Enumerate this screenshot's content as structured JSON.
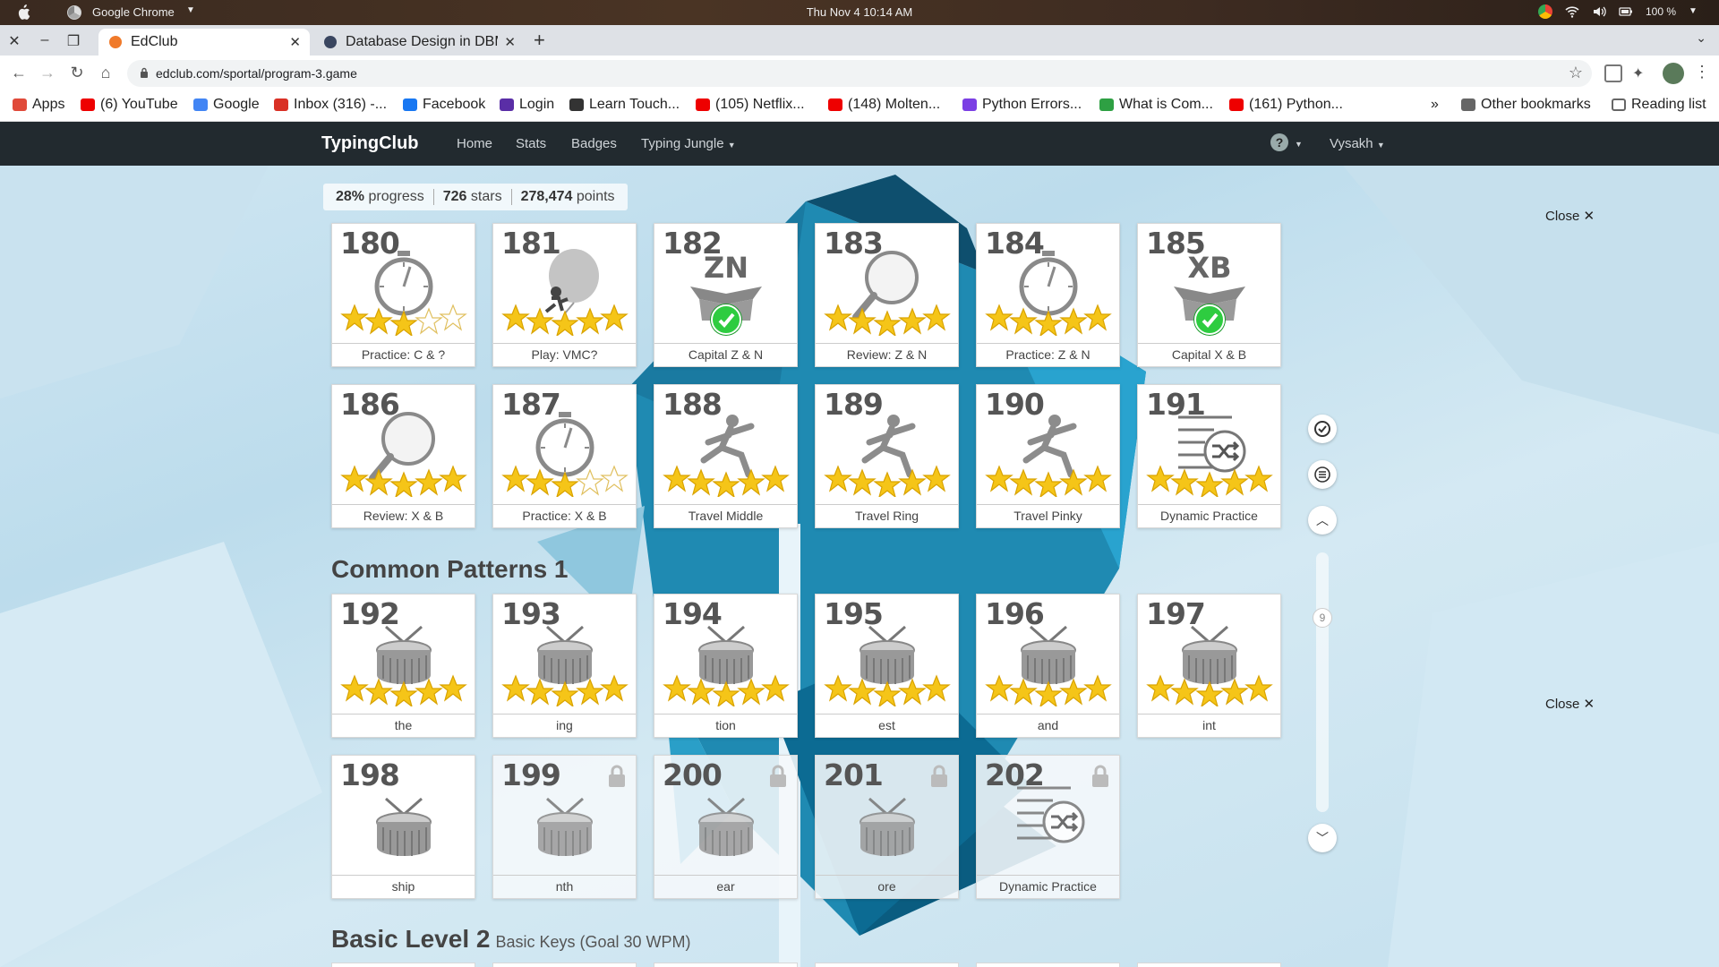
{
  "os": {
    "app_name": "Google Chrome",
    "clock": "Thu Nov 4  10:14 AM",
    "battery": "100 %"
  },
  "browser": {
    "tabs": [
      {
        "title": "EdClub"
      },
      {
        "title": "Database Design in DBM"
      }
    ],
    "url": "edclub.com/sportal/program-3.game",
    "bookmarks": [
      {
        "label": "Apps",
        "icon": "apps-grid-icon",
        "color": "#e04a3a"
      },
      {
        "label": "(6) YouTube",
        "icon": "youtube-icon",
        "color": "#e00"
      },
      {
        "label": "Google",
        "icon": "google-icon",
        "color": "#4285f4"
      },
      {
        "label": "Inbox (316) -...",
        "icon": "gmail-icon",
        "color": "#d93025"
      },
      {
        "label": "Facebook",
        "icon": "facebook-icon",
        "color": "#1877f2"
      },
      {
        "label": "Login",
        "icon": "login-icon",
        "color": "#5a2ea6"
      },
      {
        "label": "Learn Touch...",
        "icon": "typing-icon",
        "color": "#333"
      },
      {
        "label": "(105) Netflix...",
        "icon": "youtube-icon",
        "color": "#e00"
      },
      {
        "label": "(148) Molten...",
        "icon": "youtube-icon",
        "color": "#e00"
      },
      {
        "label": "Python Errors...",
        "icon": "python-icon",
        "color": "#7b3fe4"
      },
      {
        "label": "What is Com...",
        "icon": "link-icon",
        "color": "#2ea043"
      },
      {
        "label": "(161) Python...",
        "icon": "youtube-icon",
        "color": "#e00"
      }
    ],
    "overflow": "»",
    "other_bookmarks": "Other bookmarks",
    "reading_list": "Reading list"
  },
  "site": {
    "brand": "TypingClub",
    "nav": [
      "Home",
      "Stats",
      "Badges",
      "Typing Jungle"
    ],
    "user": "Vysakh"
  },
  "stats": {
    "progress": "28%",
    "progress_label": "progress",
    "stars": "726",
    "stars_label": "stars",
    "points": "278,474",
    "points_label": "points"
  },
  "close_label": "Close",
  "lessons": [
    {
      "num": "180",
      "label": "Practice: C & ?",
      "icon": "stopwatch-icon",
      "stars": 3,
      "locked": false
    },
    {
      "num": "181",
      "label": "Play: VMC?",
      "icon": "balloon-game-icon",
      "stars": 5,
      "locked": false
    },
    {
      "num": "182",
      "label": "Capital Z & N",
      "icon": "video-box-icon",
      "box_text": "ZN",
      "check": true,
      "stars": 0,
      "locked": false
    },
    {
      "num": "183",
      "label": "Review: Z & N",
      "icon": "magnifier-icon",
      "stars": 5,
      "locked": false
    },
    {
      "num": "184",
      "label": "Practice: Z & N",
      "icon": "stopwatch-icon",
      "stars": 5,
      "locked": false
    },
    {
      "num": "185",
      "label": "Capital X & B",
      "icon": "video-box-icon",
      "box_text": "XB",
      "check": true,
      "stars": 0,
      "locked": false
    },
    {
      "num": "186",
      "label": "Review: X & B",
      "icon": "magnifier-icon",
      "stars": 5,
      "locked": false
    },
    {
      "num": "187",
      "label": "Practice: X & B",
      "icon": "stopwatch-icon",
      "stars": 3,
      "locked": false
    },
    {
      "num": "188",
      "label": "Travel Middle",
      "icon": "runner-icon",
      "stars": 5,
      "locked": false
    },
    {
      "num": "189",
      "label": "Travel Ring",
      "icon": "runner-icon",
      "stars": 5,
      "locked": false
    },
    {
      "num": "190",
      "label": "Travel Pinky",
      "icon": "runner-icon",
      "stars": 5,
      "locked": false
    },
    {
      "num": "191",
      "label": "Dynamic Practice",
      "icon": "shuffle-list-icon",
      "stars": 5,
      "locked": false
    },
    {
      "num": "192",
      "label": "the",
      "icon": "drum-icon",
      "stars": 5,
      "locked": false
    },
    {
      "num": "193",
      "label": "ing",
      "icon": "drum-icon",
      "stars": 5,
      "locked": false
    },
    {
      "num": "194",
      "label": "tion",
      "icon": "drum-icon",
      "stars": 5,
      "locked": false
    },
    {
      "num": "195",
      "label": "est",
      "icon": "drum-icon",
      "stars": 5,
      "locked": false
    },
    {
      "num": "196",
      "label": "and",
      "icon": "drum-icon",
      "stars": 5,
      "locked": false
    },
    {
      "num": "197",
      "label": "int",
      "icon": "drum-icon",
      "stars": 5,
      "locked": false
    },
    {
      "num": "198",
      "label": "ship",
      "icon": "drum-icon",
      "stars": 0,
      "locked": false
    },
    {
      "num": "199",
      "label": "nth",
      "icon": "drum-icon",
      "stars": 0,
      "locked": true
    },
    {
      "num": "200",
      "label": "ear",
      "icon": "drum-icon",
      "stars": 0,
      "locked": true
    },
    {
      "num": "201",
      "label": "ore",
      "icon": "drum-icon",
      "stars": 0,
      "locked": true
    },
    {
      "num": "202",
      "label": "Dynamic Practice",
      "icon": "shuffle-list-icon",
      "stars": 0,
      "locked": true
    }
  ],
  "sections": [
    {
      "title": "Common Patterns 1",
      "subtitle": ""
    },
    {
      "title": "Basic Level 2",
      "subtitle": "Basic Keys (Goal 30 WPM)"
    }
  ],
  "scroll_page": "9",
  "colors": {
    "star": "#f5c518",
    "nav_bg": "#222a2f",
    "check": "#2ecc40"
  }
}
